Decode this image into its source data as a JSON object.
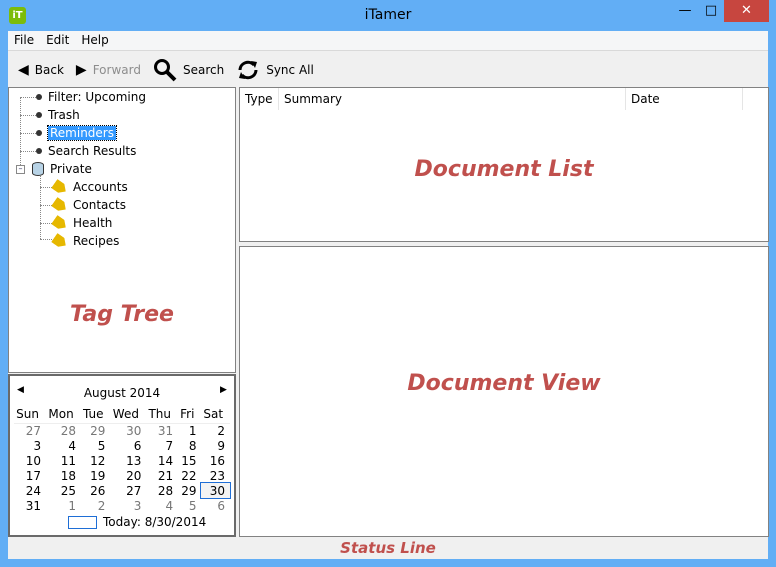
{
  "window": {
    "title": "iTamer",
    "icon_text": "iT",
    "controls": [
      "minimize",
      "maximize",
      "close"
    ]
  },
  "menu": [
    "File",
    "Edit",
    "Help"
  ],
  "toolbar": {
    "back": "Back",
    "forward": "Forward",
    "search": "Search",
    "sync": "Sync All"
  },
  "tree": {
    "items": [
      "Filter: Upcoming",
      "Trash",
      "Reminders",
      "Search Results"
    ],
    "selected": "Reminders",
    "root": "Private",
    "tags": [
      "Accounts",
      "Contacts",
      "Health",
      "Recipes"
    ],
    "watermark": "Tag Tree"
  },
  "calendar": {
    "month": "August 2014",
    "weekdays": [
      "Sun",
      "Mon",
      "Tue",
      "Wed",
      "Thu",
      "Fri",
      "Sat"
    ],
    "weeks": [
      [
        "27",
        "28",
        "29",
        "30",
        "31",
        "1",
        "2"
      ],
      [
        "3",
        "4",
        "5",
        "6",
        "7",
        "8",
        "9"
      ],
      [
        "10",
        "11",
        "12",
        "13",
        "14",
        "15",
        "16"
      ],
      [
        "17",
        "18",
        "19",
        "20",
        "21",
        "22",
        "23"
      ],
      [
        "24",
        "25",
        "26",
        "27",
        "28",
        "29",
        "30"
      ],
      [
        "31",
        "1",
        "2",
        "3",
        "4",
        "5",
        "6"
      ]
    ],
    "selected": "30",
    "today": "Today: 8/30/2014"
  },
  "doclist": {
    "columns": [
      "Type",
      "Summary",
      "Date"
    ],
    "watermark": "Document List"
  },
  "docview": {
    "watermark": "Document View"
  },
  "status": {
    "watermark": "Status Line"
  }
}
